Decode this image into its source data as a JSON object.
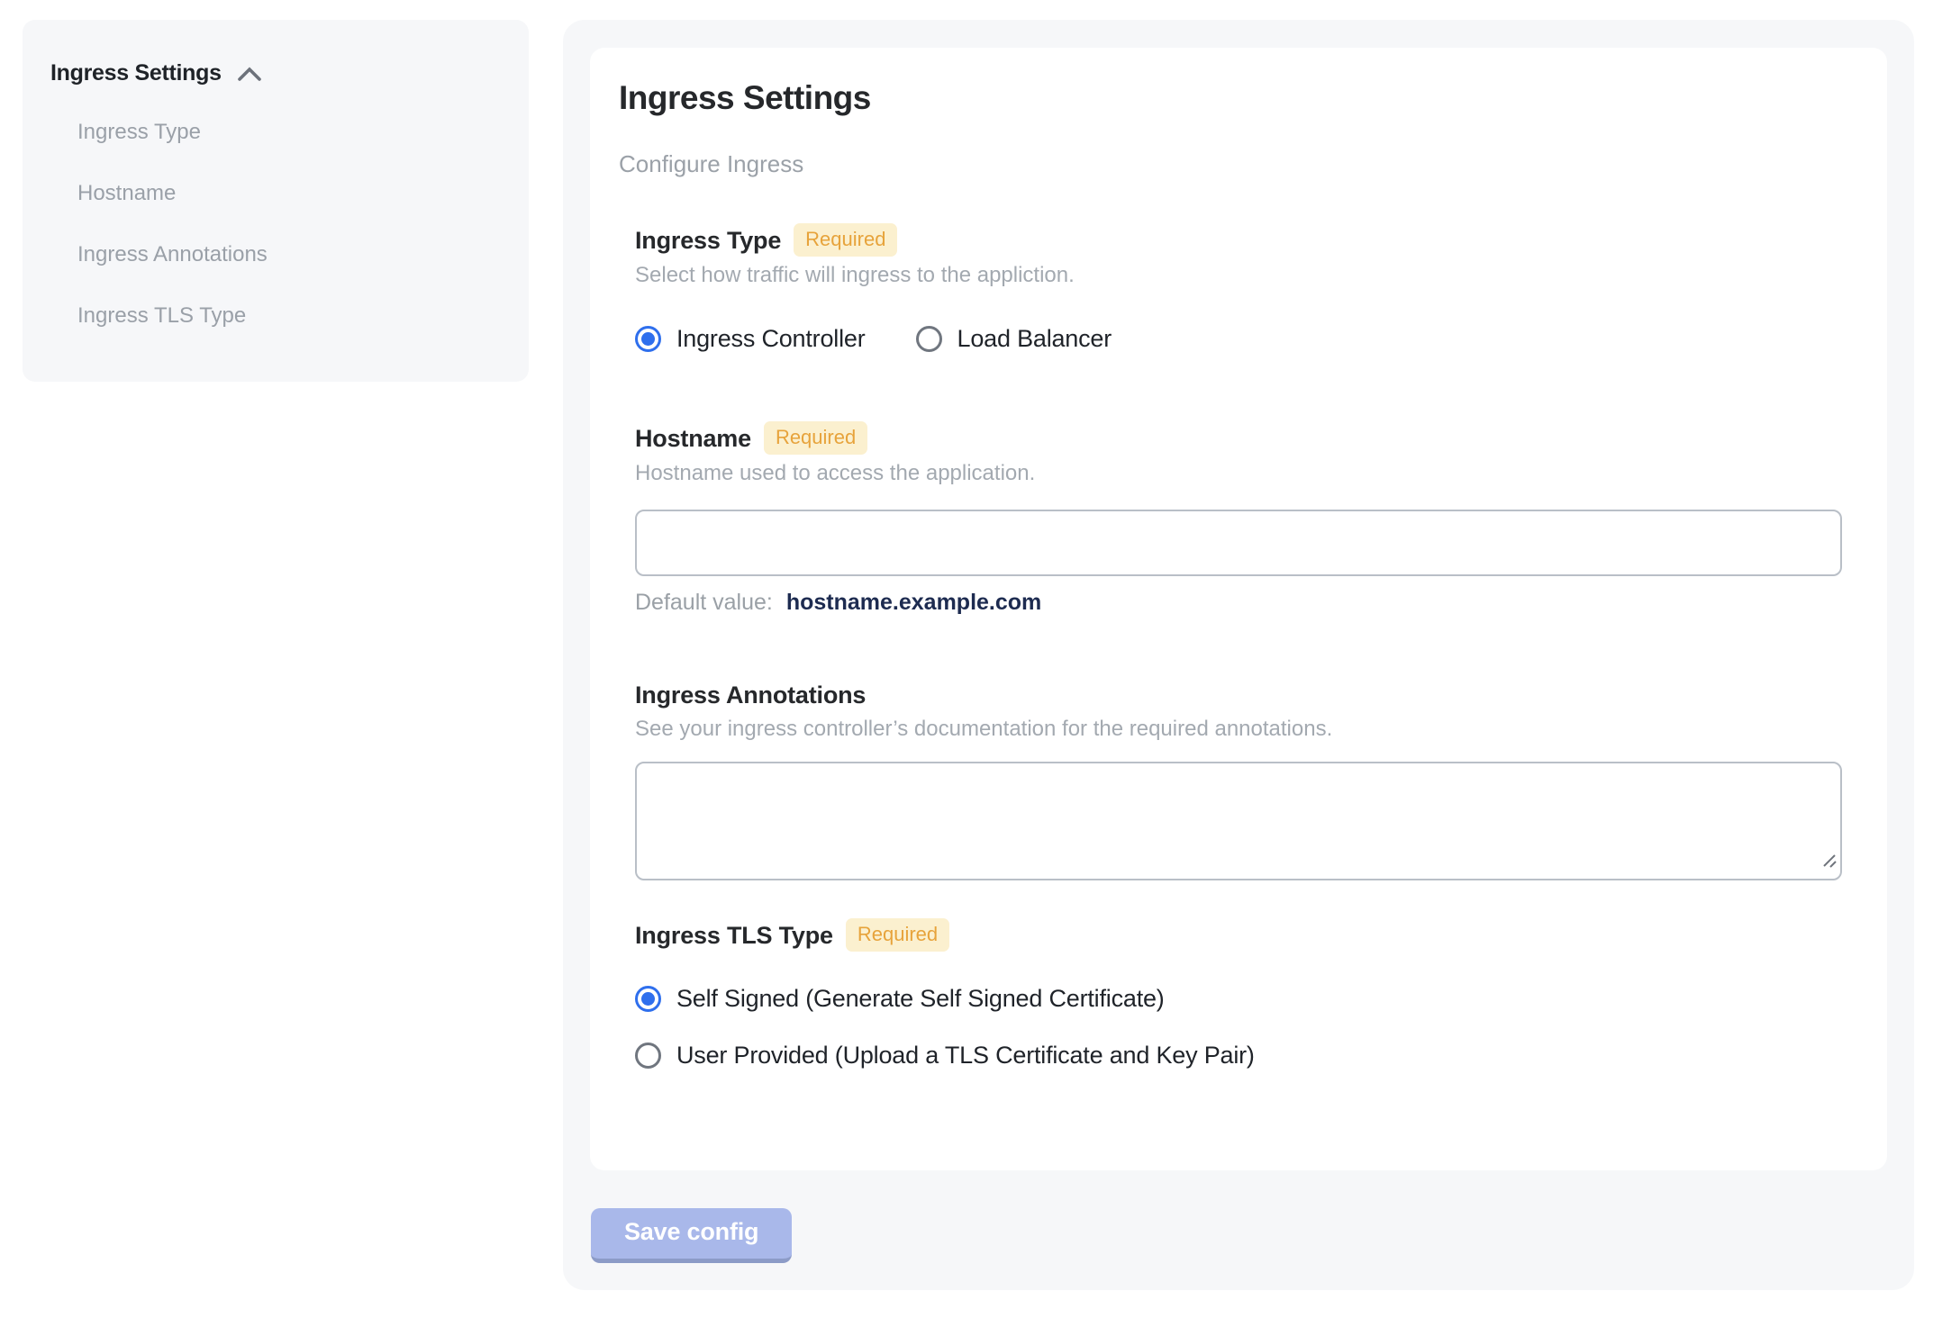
{
  "sidebar": {
    "header": {
      "label": "Ingress Settings",
      "collapse_icon": "chevron-up"
    },
    "items": [
      {
        "label": "Ingress Type"
      },
      {
        "label": "Hostname"
      },
      {
        "label": "Ingress Annotations"
      },
      {
        "label": "Ingress TLS Type"
      }
    ]
  },
  "panel": {
    "title": "Ingress Settings",
    "subtitle": "Configure Ingress",
    "required_badge": "Required",
    "sections": {
      "ingress_type": {
        "label": "Ingress Type",
        "required": true,
        "helper": "Select how traffic will ingress to the appliction.",
        "options": [
          {
            "label": "Ingress Controller",
            "selected": true
          },
          {
            "label": "Load Balancer",
            "selected": false
          }
        ]
      },
      "hostname": {
        "label": "Hostname",
        "required": true,
        "helper": "Hostname used to access the application.",
        "input_value": "",
        "default_value_label": "Default value:",
        "default_value": "hostname.example.com"
      },
      "ingress_annotations": {
        "label": "Ingress Annotations",
        "required": false,
        "helper": "See your ingress controller’s documentation for the required annotations.",
        "textarea_value": ""
      },
      "ingress_tls_type": {
        "label": "Ingress TLS Type",
        "required": true,
        "options": [
          {
            "label": "Self Signed (Generate Self Signed Certificate)",
            "selected": true
          },
          {
            "label": "User Provided (Upload a TLS Certificate and Key Pair)",
            "selected": false
          }
        ]
      }
    }
  },
  "save_button": {
    "label": "Save config",
    "disabled": true
  },
  "icons": {
    "sidebar_collapse": "chevron-up",
    "textarea_corner": "resize-handle"
  },
  "colors": {
    "panel_background": "#f6f7f9",
    "card_background": "#ffffff",
    "accent_blue": "#2f6fed",
    "badge_background": "#fbf0cf",
    "badge_text": "#e7a33b",
    "muted_text": "#a3a9b0",
    "default_value_text": "#1d2b50",
    "save_button_background": "#a9b8ea",
    "save_button_edge": "#8c9bc7"
  }
}
